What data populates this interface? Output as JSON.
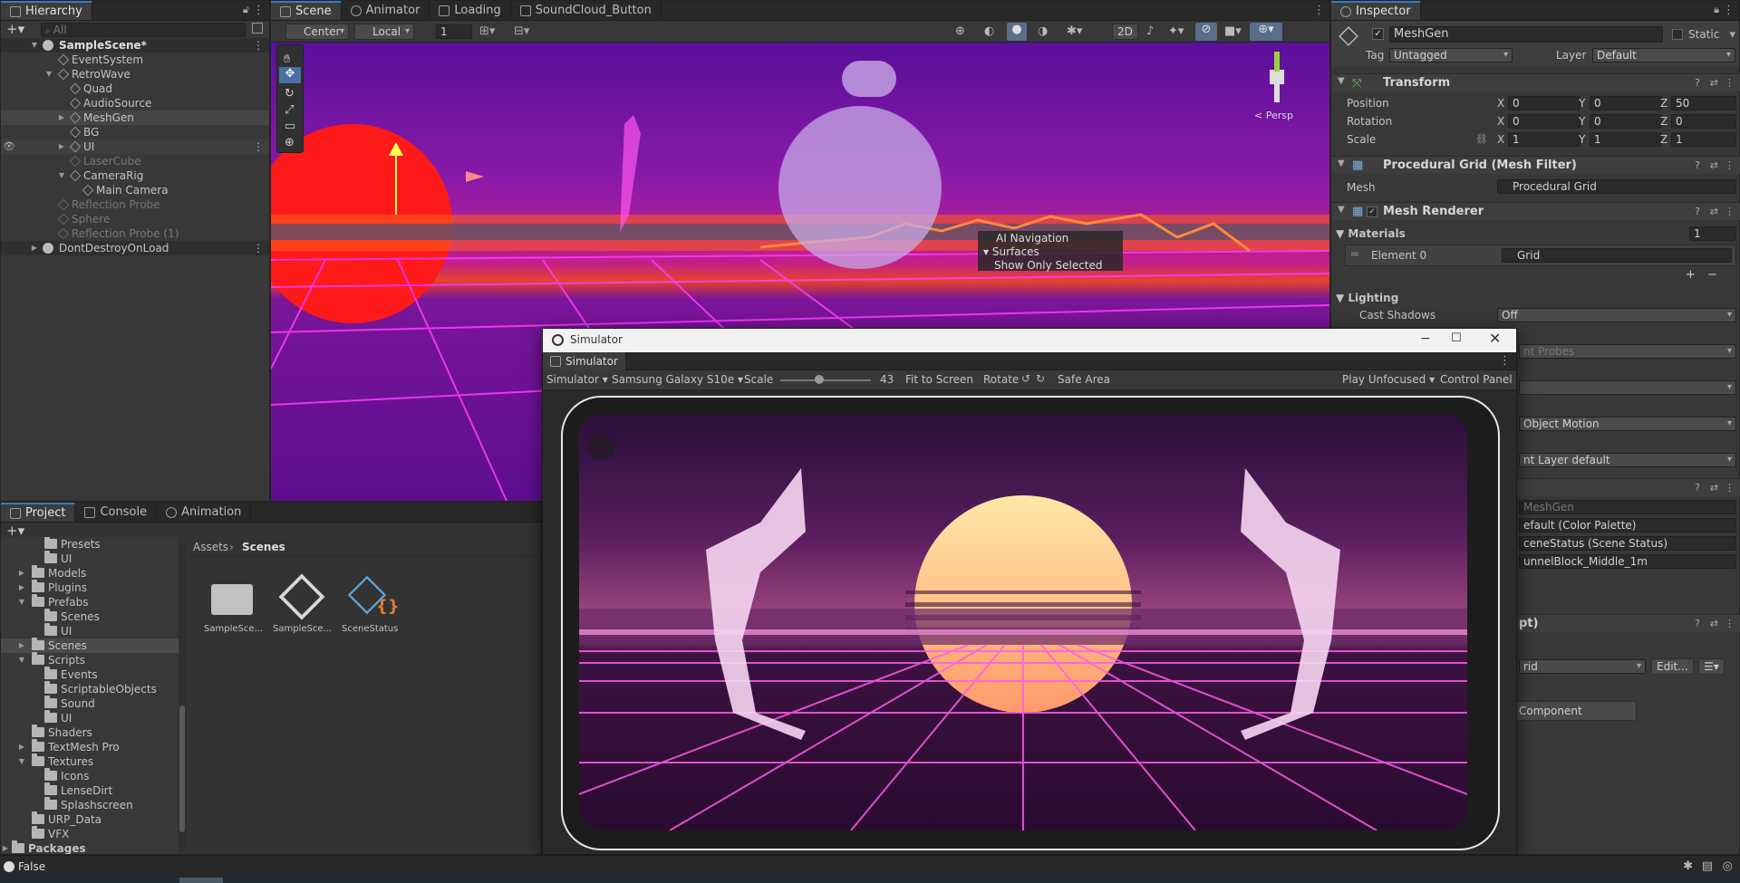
{
  "hierarchy": {
    "tab_label": "Hierarchy",
    "search_placeholder": "All",
    "rows": [
      {
        "label": "SampleScene*"
      },
      {
        "label": "EventSystem"
      },
      {
        "label": "RetroWave"
      },
      {
        "label": "Quad"
      },
      {
        "label": "AudioSource"
      },
      {
        "label": "MeshGen"
      },
      {
        "label": "BG"
      },
      {
        "label": "UI"
      },
      {
        "label": "LaserCube"
      },
      {
        "label": "CameraRig"
      },
      {
        "label": "Main Camera"
      },
      {
        "label": "Reflection Probe"
      },
      {
        "label": "Sphere"
      },
      {
        "label": "Reflection Probe (1)"
      },
      {
        "label": "DontDestroyOnLoad"
      }
    ]
  },
  "scene": {
    "tabs": [
      "Scene",
      "Animator",
      "Loading",
      "SoundCloud_Button"
    ],
    "pivot_mode": "Center",
    "pivot_space": "Local",
    "grid_value": "1",
    "mode_2d": "2D",
    "persp_label": "< Persp",
    "overlay": {
      "title": "AI Navigation",
      "item1": "Surfaces",
      "item2": "Show Only Selected"
    }
  },
  "inspector": {
    "tab_label": "Inspector",
    "object_name": "MeshGen",
    "static_label": "Static",
    "tag_label": "Tag",
    "tag_value": "Untagged",
    "layer_label": "Layer",
    "layer_value": "Default",
    "transform": {
      "title": "Transform",
      "position_label": "Position",
      "position": [
        "0",
        "0",
        "50"
      ],
      "rotation_label": "Rotation",
      "rotation": [
        "0",
        "0",
        "0"
      ],
      "scale_label": "Scale",
      "scale": [
        "1",
        "1",
        "1"
      ],
      "axis_x": "X",
      "axis_y": "Y",
      "axis_z": "Z"
    },
    "mesh_filter": {
      "title": "Procedural Grid (Mesh Filter)",
      "mesh_label": "Mesh",
      "mesh_value": "Procedural Grid"
    },
    "mesh_renderer": {
      "title": "Mesh Renderer",
      "materials_label": "Materials",
      "materials_count": "1",
      "element_label": "Element 0",
      "element_value": "Grid",
      "lighting_label": "Lighting",
      "cast_shadows_label": "Cast Shadows",
      "cast_shadows_value": "Off",
      "probes_value": "nt Probes",
      "motion_value": "Object Motion",
      "layer_value": "nt Layer default"
    },
    "partial_refs": [
      "MeshGen",
      "efault (Color Palette)",
      "ceneStatus (Scene Status)",
      "unnelBlock_Middle_1m"
    ],
    "script_title": "pt)",
    "grid_dropdown": "rid",
    "edit_button": "Edit...",
    "add_component": "Component"
  },
  "simulator": {
    "window_title": "Simulator",
    "tab_label": "Simulator",
    "mode": "Simulator",
    "device": "Samsung Galaxy S10e",
    "scale_label": "Scale",
    "scale_value": "43",
    "scale_fraction": 0.43,
    "fit_label": "Fit to Screen",
    "rotate_label": "Rotate",
    "safe_area_label": "Safe Area",
    "play_mode": "Play Unfocused",
    "control_panel": "Control Panel"
  },
  "project": {
    "tabs": [
      "Project",
      "Console",
      "Animation"
    ],
    "tree": [
      {
        "label": "Presets",
        "indent": 2
      },
      {
        "label": "UI",
        "indent": 2
      },
      {
        "label": "Models",
        "indent": 1
      },
      {
        "label": "Plugins",
        "indent": 1
      },
      {
        "label": "Prefabs",
        "indent": 1
      },
      {
        "label": "Scenes",
        "indent": 2
      },
      {
        "label": "UI",
        "indent": 2
      },
      {
        "label": "Scenes",
        "indent": 1
      },
      {
        "label": "Scripts",
        "indent": 1
      },
      {
        "label": "Events",
        "indent": 2
      },
      {
        "label": "ScriptableObjects",
        "indent": 2
      },
      {
        "label": "Sound",
        "indent": 2
      },
      {
        "label": "UI",
        "indent": 2
      },
      {
        "label": "Shaders",
        "indent": 1
      },
      {
        "label": "TextMesh Pro",
        "indent": 1
      },
      {
        "label": "Textures",
        "indent": 1
      },
      {
        "label": "Icons",
        "indent": 2
      },
      {
        "label": "LenseDirt",
        "indent": 2
      },
      {
        "label": "Splashscreen",
        "indent": 2
      },
      {
        "label": "URP_Data",
        "indent": 1
      },
      {
        "label": "VFX",
        "indent": 1
      },
      {
        "label": "Packages",
        "indent": 0
      }
    ],
    "breadcrumb_root": "Assets",
    "breadcrumb_current": "Scenes",
    "assets": [
      "SampleSce...",
      "SampleSce...",
      "SceneStatus"
    ]
  },
  "status": {
    "text": "False"
  },
  "colors": {
    "accent": "#3a79bb",
    "panel": "#383838",
    "dark": "#282828",
    "neon": "#ff3cff"
  }
}
